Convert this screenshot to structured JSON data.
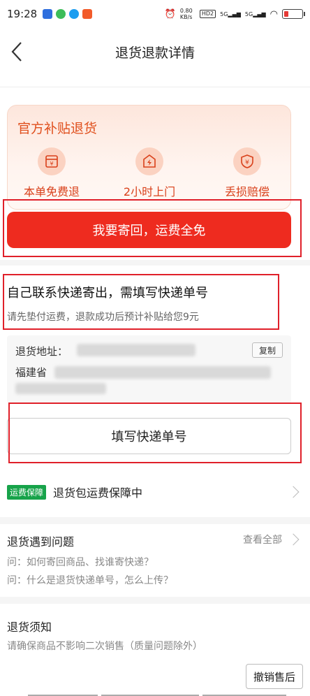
{
  "status_bar": {
    "time": "19:28",
    "net_speed": "0.80 KB/s",
    "hd": "HD2",
    "signal1": "5G",
    "signal2": "5G"
  },
  "header": {
    "title": "退货退款详情"
  },
  "subsidy": {
    "title": "官方补贴退货",
    "benefits": [
      {
        "label": "本单免费退",
        "icon": "receipt-yen-icon"
      },
      {
        "label": "2小时上门",
        "icon": "lightning-house-icon"
      },
      {
        "label": "丢损赔偿",
        "icon": "shield-yen-icon"
      }
    ],
    "primary_button": "我要寄回，运费全免"
  },
  "self_ship": {
    "title": "自己联系快递寄出，需填写快递单号",
    "subtitle": "请先垫付运费，退款成功后预计补贴给您9元",
    "address_label": "退货地址：",
    "address_province": "福建省",
    "copy_label": "复制",
    "fill_tracking_button": "填写快递单号"
  },
  "shipping_guarantee": {
    "badge": "运费保障",
    "text": "退货包运费保障中"
  },
  "problems": {
    "title": "退货遇到问题",
    "view_all": "查看全部",
    "questions": [
      "问：如何寄回商品、找谁寄快递？",
      "问：什么是退货快递单号，怎么上传？"
    ]
  },
  "notice": {
    "title": "退货须知",
    "text": "请确保商品不影响二次销售（质量问题除外）"
  },
  "footer": {
    "after_sale_button": "撤销售后"
  },
  "colors": {
    "accent_red": "#ee2b1f",
    "subsidy_orange": "#e0501e",
    "guarantee_green": "#17a34a"
  }
}
